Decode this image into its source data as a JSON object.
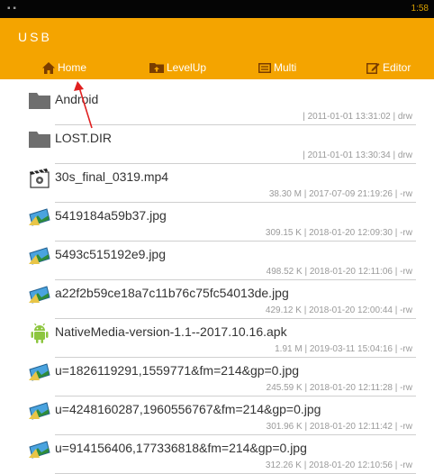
{
  "statusbar": {
    "time": "1:58"
  },
  "app": {
    "title": "USB"
  },
  "toolbar": {
    "home": "Home",
    "levelup": "LevelUp",
    "multi": "Multi",
    "editor": "Editor"
  },
  "files": [
    {
      "name": "Android",
      "meta": "| 2011-01-01 13:31:02 | drw",
      "icon": "folder-icon"
    },
    {
      "name": "LOST.DIR",
      "meta": "| 2011-01-01 13:30:34 | drw",
      "icon": "folder-icon"
    },
    {
      "name": "30s_final_0319.mp4",
      "meta": "38.30 M | 2017-07-09 21:19:26 | -rw",
      "icon": "video-icon"
    },
    {
      "name": "5419184a59b37.jpg",
      "meta": "309.15 K | 2018-01-20 12:09:30 | -rw",
      "icon": "image-icon"
    },
    {
      "name": "5493c515192e9.jpg",
      "meta": "498.52 K | 2018-01-20 12:11:06 | -rw",
      "icon": "image-icon"
    },
    {
      "name": "a22f2b59ce18a7c11b76c75fc54013de.jpg",
      "meta": "429.12 K | 2018-01-20 12:00:44 | -rw",
      "icon": "image-icon"
    },
    {
      "name": "NativeMedia-version-1.1--2017.10.16.apk",
      "meta": "1.91 M | 2019-03-11 15:04:16 | -rw",
      "icon": "android-icon"
    },
    {
      "name": "u=1826119291,1559771&fm=214&gp=0.jpg",
      "meta": "245.59 K | 2018-01-20 12:11:28 | -rw",
      "icon": "image-icon"
    },
    {
      "name": "u=4248160287,1960556767&fm=214&gp=0.jpg",
      "meta": "301.96 K | 2018-01-20 12:11:42 | -rw",
      "icon": "image-icon"
    },
    {
      "name": "u=914156406,177336818&fm=214&gp=0.jpg",
      "meta": "312.26 K | 2018-01-20 12:10:56 | -rw",
      "icon": "image-icon"
    }
  ],
  "colors": {
    "accent": "#f4a400",
    "annotation": "#e02020"
  }
}
